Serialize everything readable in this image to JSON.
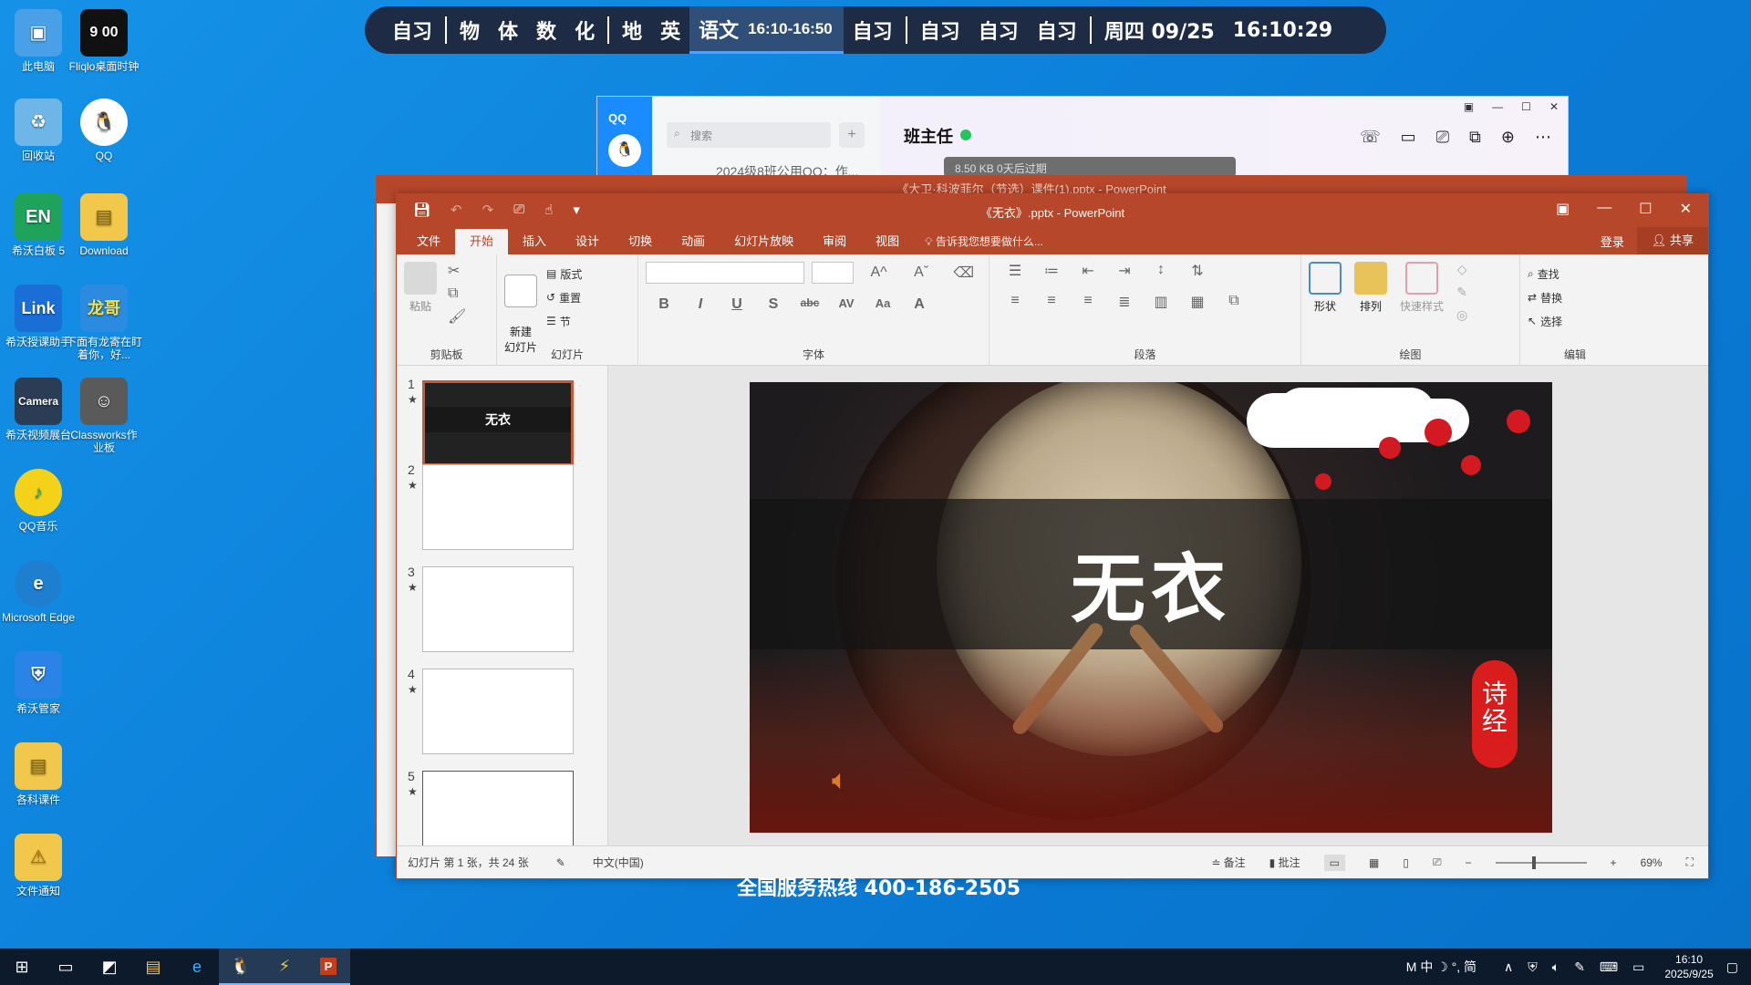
{
  "desktop_icons": [
    {
      "label": "此电脑",
      "icon": "computer-icon",
      "color": "#4aa0e6"
    },
    {
      "label": "Fliqlo桌面时钟",
      "icon": "clock-icon",
      "color": "#111111",
      "img_text": "9 00"
    },
    {
      "label": "回收站",
      "icon": "recycle-bin-icon",
      "color": "#6fb6e8"
    },
    {
      "label": "QQ",
      "icon": "qq-icon",
      "color": "#ffffff"
    },
    {
      "label": "希沃白板 5",
      "icon": "seewo-board-icon",
      "color": "#1fa35a",
      "img_text": "EN"
    },
    {
      "label": "Download",
      "icon": "folder-icon",
      "color": "#f1c84b"
    },
    {
      "label": "希沃授课助手",
      "icon": "seewo-link-icon",
      "color": "#1a6fd6",
      "img_text": "Link"
    },
    {
      "label": "下面有龙寄在盯着你，好...",
      "icon": "peek-icon",
      "color": "#2a8be0",
      "img_text": "龙哥"
    },
    {
      "label": "希沃视频展台",
      "icon": "camera-icon",
      "color": "#2b3d55",
      "img_text": "Camera"
    },
    {
      "label": "Classworks作业板",
      "icon": "classworks-icon",
      "color": "#5a5a5a"
    },
    {
      "label": "QQ音乐",
      "icon": "qq-music-icon",
      "color": "#f5d21a"
    },
    {
      "label": "Microsoft Edge",
      "icon": "edge-icon",
      "color": "#1e7fd1"
    },
    {
      "label": "希沃管家",
      "icon": "shield-icon",
      "color": "#2a83e6"
    },
    {
      "label": "各科课件",
      "icon": "folder-icon",
      "color": "#f1c84b"
    },
    {
      "label": "文件通知",
      "icon": "warning-folder-icon",
      "color": "#f1c84b"
    }
  ],
  "schedule": {
    "items": [
      "自习",
      "物",
      "体",
      "数",
      "化",
      "地",
      "英",
      "语文",
      "自习",
      "自习",
      "自习",
      "自习",
      "周四 09/25"
    ],
    "active_label": "语文",
    "active_time": "16:10-16:50",
    "time": "16:10:29"
  },
  "qq_window": {
    "logo": "QQ",
    "search_placeholder": "搜索",
    "chat_preview": "2024级8班公用QQ：作...",
    "chat_title": "班主任",
    "file_preview": "8.50 KB 0天后过期",
    "status_color": "#21c55d"
  },
  "back_window": {
    "title": "《大卫·科波菲尔（节选）课件(1).pptx - PowerPoint"
  },
  "ppt": {
    "title": "《无衣》.pptx - PowerPoint",
    "tabs": [
      "文件",
      "开始",
      "插入",
      "设计",
      "切换",
      "动画",
      "幻灯片放映",
      "审阅",
      "视图"
    ],
    "active_tab": "开始",
    "tell_me": "告诉我您想要做什么...",
    "signin": "登录",
    "share": "共享",
    "groups": {
      "clipboard": {
        "label": "剪贴板",
        "paste": "粘贴"
      },
      "slides": {
        "label": "幻灯片",
        "new_slide": "新建\n幻灯片",
        "layout": "版式",
        "reset": "重置",
        "section": "节"
      },
      "font": {
        "label": "字体",
        "bold": "B",
        "italic": "I",
        "underline": "U",
        "shadow": "S",
        "strike": "abc",
        "spacing": "AV",
        "case": "Aa",
        "color": "A"
      },
      "paragraph": {
        "label": "段落"
      },
      "drawing": {
        "label": "绘图",
        "shapes": "形状",
        "arrange": "排列",
        "quick_styles": "快速样式"
      },
      "editing": {
        "label": "编辑",
        "find": "查找",
        "replace": "替换",
        "select": "选择"
      }
    },
    "thumbs": [
      {
        "num": "1",
        "title": "无衣"
      },
      {
        "num": "2",
        "title": ""
      },
      {
        "num": "3",
        "title": ""
      },
      {
        "num": "4",
        "title": ""
      },
      {
        "num": "5",
        "title": ""
      }
    ],
    "slide": {
      "title": "无衣",
      "seal_text": "诗经",
      "accent": "#d91d1d"
    },
    "status": {
      "slide_info": "幻灯片 第 1 张，共 24 张",
      "language": "中文(中国)",
      "notes": "备注",
      "comments": "批注",
      "zoom": "69%"
    }
  },
  "hotline": "全国服务热线 400-186-2505",
  "taskbar": {
    "items": [
      "start-icon",
      "task-view-icon",
      "seewo-icon",
      "file-explorer-icon",
      "edge-icon",
      "qq-icon",
      "classworks-icon",
      "powerpoint-icon"
    ],
    "active": "powerpoint-icon",
    "ime": "M 中 ☽ °, 简",
    "time": "16:10",
    "date": "2025/9/25"
  }
}
